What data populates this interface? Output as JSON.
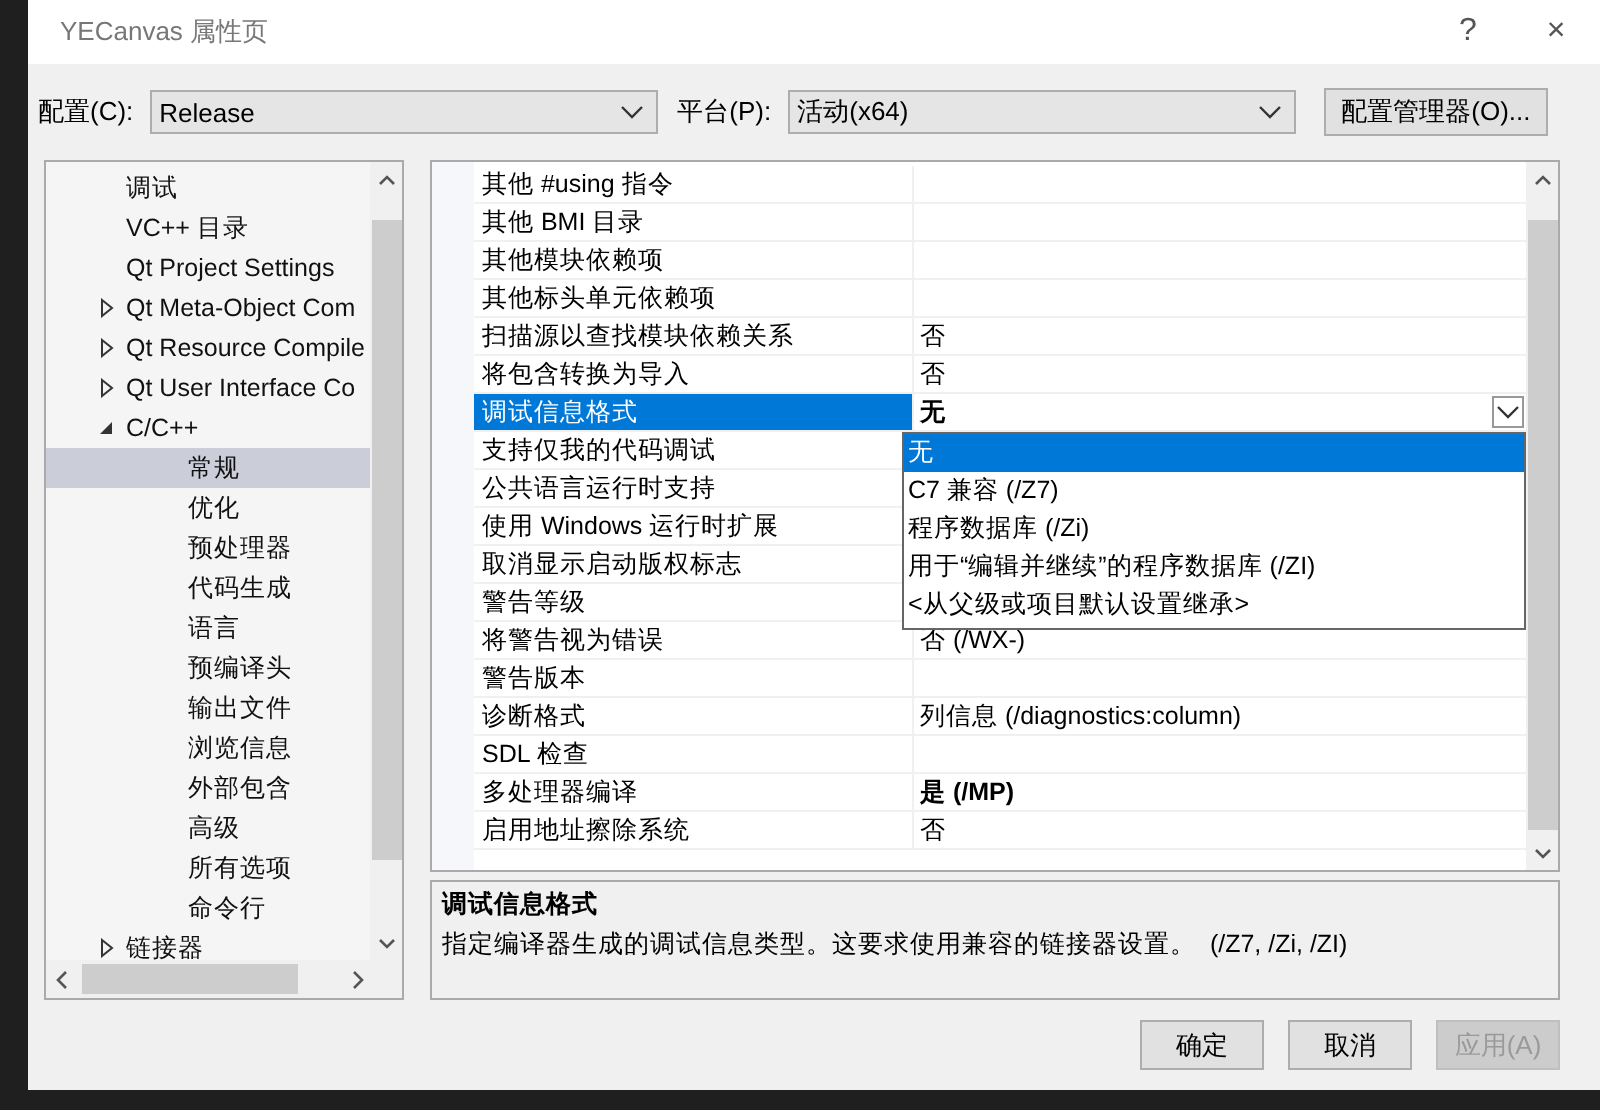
{
  "window": {
    "title": "YECanvas 属性页",
    "help": "?",
    "close": "×"
  },
  "config_bar": {
    "configuration_label": "配置(C):",
    "configuration": "Release",
    "platform_label": "平台(P):",
    "platform": "活动(x64)",
    "manager_button": "配置管理器(O)..."
  },
  "tree": {
    "items": [
      {
        "label": "调试",
        "selected": false
      },
      {
        "label": "VC++ 目录",
        "selected": false
      },
      {
        "label": "Qt Project Settings",
        "selected": false
      },
      {
        "label": "Qt Meta-Object Com",
        "selected": false,
        "expanded": false
      },
      {
        "label": "Qt Resource Compile",
        "selected": false,
        "expanded": false
      },
      {
        "label": "Qt User Interface Co",
        "selected": false,
        "expanded": false
      },
      {
        "label": "C/C++",
        "selected": false,
        "expanded": true,
        "children": [
          {
            "label": "常规",
            "selected": true
          },
          {
            "label": "优化",
            "selected": false
          },
          {
            "label": "预处理器",
            "selected": false
          },
          {
            "label": "代码生成",
            "selected": false
          },
          {
            "label": "语言",
            "selected": false
          },
          {
            "label": "预编译头",
            "selected": false
          },
          {
            "label": "输出文件",
            "selected": false
          },
          {
            "label": "浏览信息",
            "selected": false
          },
          {
            "label": "外部包含",
            "selected": false
          },
          {
            "label": "高级",
            "selected": false
          },
          {
            "label": "所有选项",
            "selected": false
          },
          {
            "label": "命令行",
            "selected": false
          }
        ]
      },
      {
        "label": "链接器",
        "selected": false,
        "expanded": false
      }
    ]
  },
  "grid": {
    "rows": [
      {
        "name": "其他 #using 指令",
        "selected": false
      },
      {
        "name": "其他 BMI 目录",
        "selected": false
      },
      {
        "name": "其他模块依赖项",
        "selected": false
      },
      {
        "name": "其他标头单元依赖项",
        "selected": false
      },
      {
        "name": "扫描源以查找模块依赖关系",
        "value": "否",
        "bold": false,
        "selected": false
      },
      {
        "name": "将包含转换为导入",
        "value": "否",
        "bold": false,
        "selected": false
      },
      {
        "name": "调试信息格式",
        "value": "无",
        "bold": true,
        "selected": true
      },
      {
        "name": "支持仅我的代码调试",
        "selected": false
      },
      {
        "name": "公共语言运行时支持",
        "selected": false
      },
      {
        "name": "使用 Windows 运行时扩展",
        "selected": false
      },
      {
        "name": "取消显示启动版权标志",
        "selected": false
      },
      {
        "name": "警告等级",
        "selected": false
      },
      {
        "name": "将警告视为错误",
        "value": "否 (/WX-)",
        "bold": false,
        "selected": false
      },
      {
        "name": "警告版本",
        "selected": false
      },
      {
        "name": "诊断格式",
        "value": "列信息 (/diagnostics:column)",
        "bold": false,
        "selected": false
      },
      {
        "name": "SDL 检查",
        "selected": false
      },
      {
        "name": "多处理器编译",
        "value": "是 (/MP)",
        "bold": true,
        "selected": false
      },
      {
        "name": "启用地址擦除系统",
        "value": "否",
        "bold": false,
        "selected": false
      }
    ],
    "dropdown_options": [
      {
        "label": "无",
        "selected": true
      },
      {
        "label": "C7 兼容 (/Z7)",
        "selected": false
      },
      {
        "label": "程序数据库 (/Zi)",
        "selected": false
      },
      {
        "label": "用于“编辑并继续”的程序数据库 (/ZI)",
        "selected": false
      },
      {
        "label": "<从父级或项目默认设置继承>",
        "selected": false
      }
    ]
  },
  "description": {
    "title": "调试信息格式",
    "text": "指定编译器生成的调试信息类型。这要求使用兼容的链接器设置。  (/Z7, /Zi, /ZI)"
  },
  "buttons": [
    {
      "label": "确定",
      "disabled": false
    },
    {
      "label": "取消",
      "disabled": false
    },
    {
      "label": "应用(A)",
      "disabled": true
    }
  ]
}
